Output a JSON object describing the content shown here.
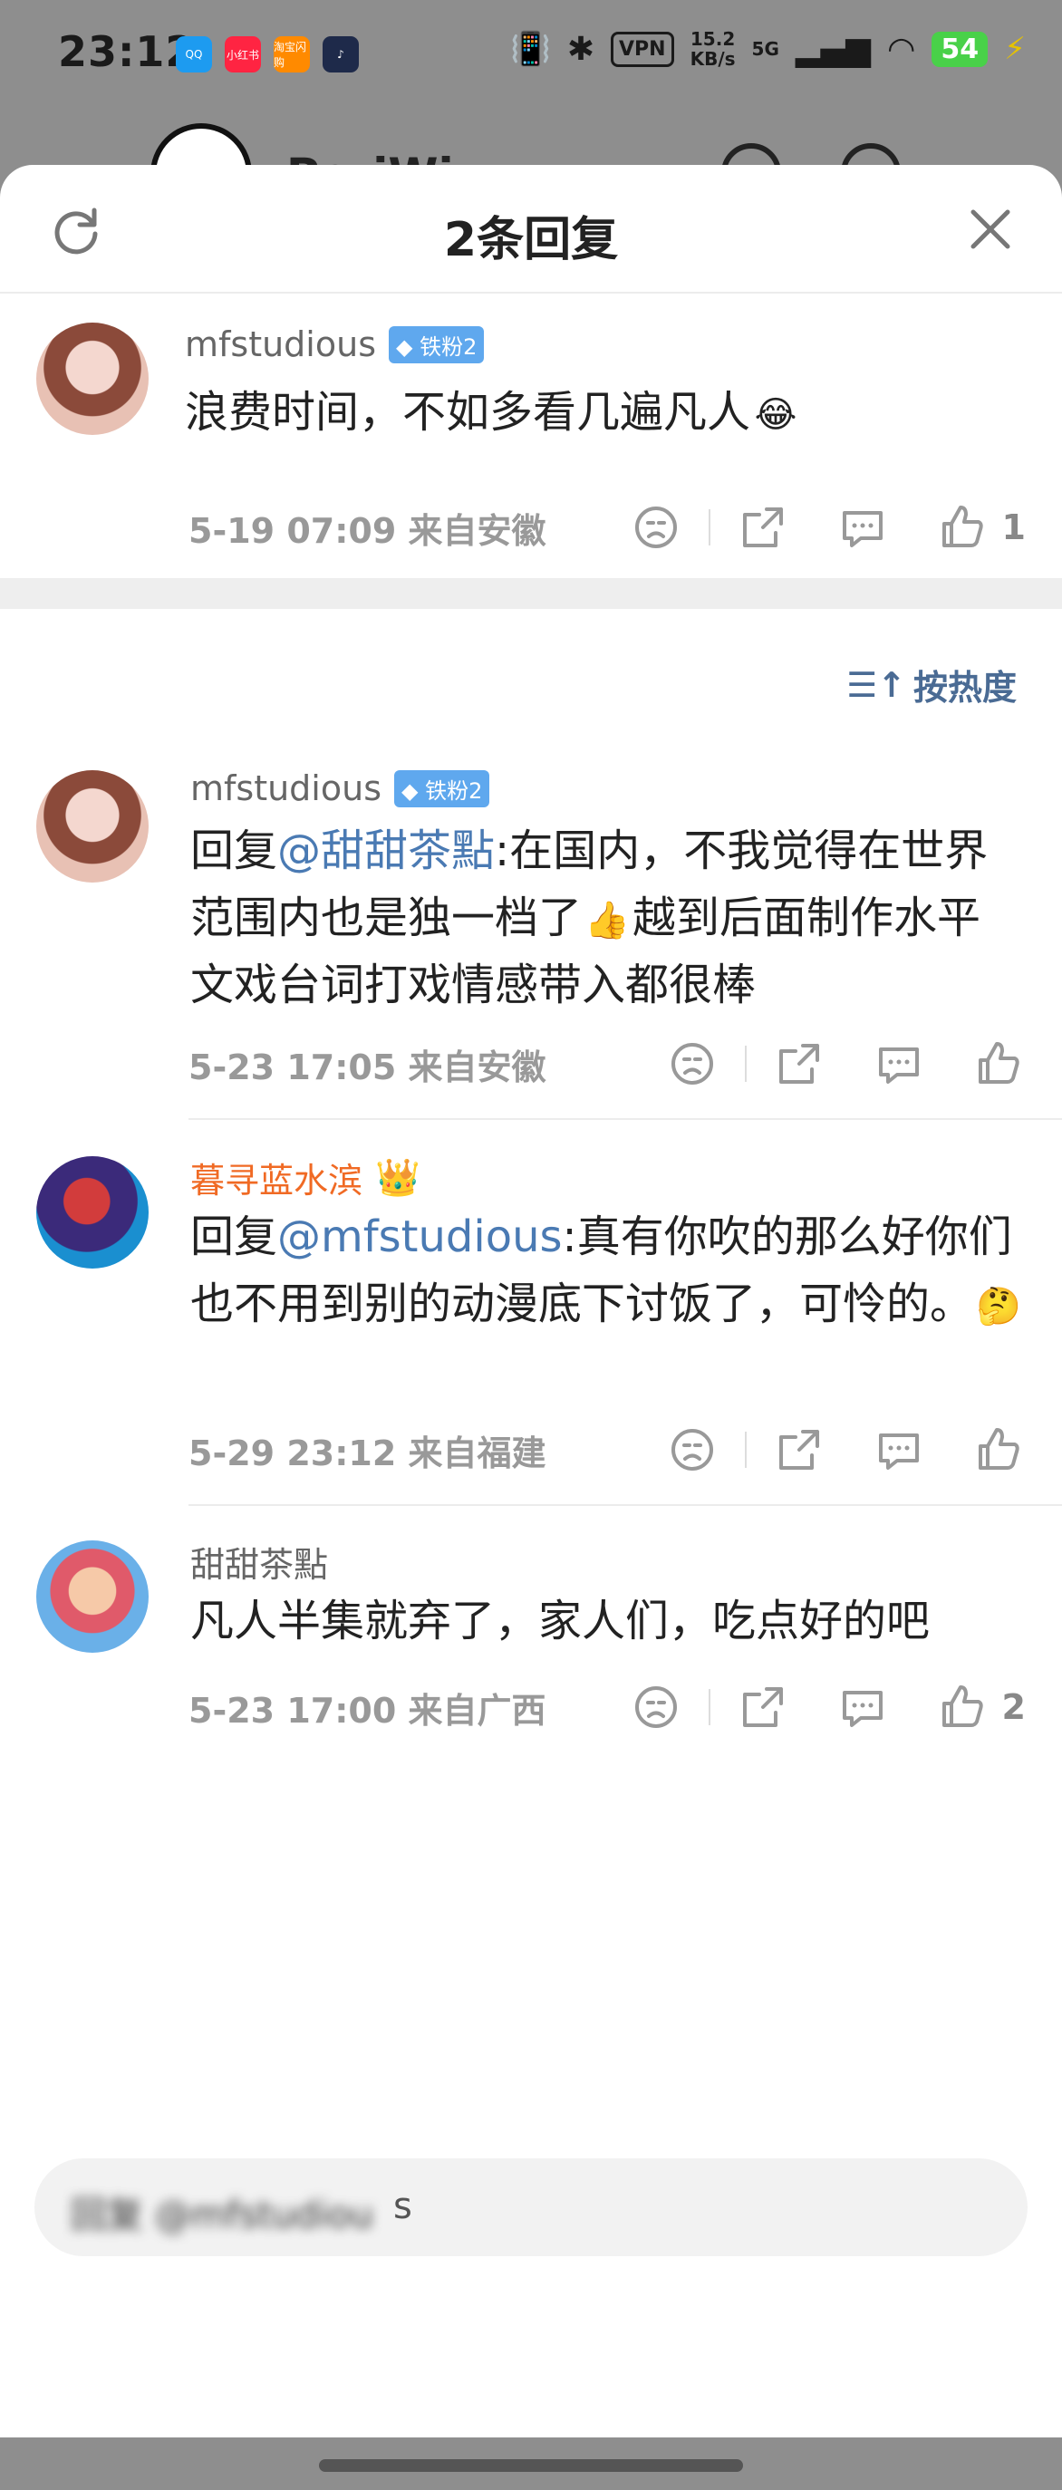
{
  "status_bar": {
    "time": "23:12",
    "vpn": "VPN",
    "speed_value": "15.2",
    "speed_unit": "KB/s",
    "network": "5G",
    "battery": "54",
    "app_icons": [
      {
        "name": "qq-icon",
        "color": "#1d9bf0",
        "label": "QQ"
      },
      {
        "name": "xiaohongshu-icon",
        "color": "#ff2442",
        "label": "小红书"
      },
      {
        "name": "taobao-flash-icon",
        "color": "#ff8a00",
        "label": "淘宝闪购"
      },
      {
        "name": "music-app-icon",
        "color": "#1e2a4a",
        "label": "♪"
      }
    ]
  },
  "background_header": {
    "back_glyph": "‹",
    "title_fragment": "PeriWi"
  },
  "sheet": {
    "title": "2条回复",
    "sort_label": "按热度"
  },
  "colors": {
    "mention": "#4a7ab3",
    "vip_name": "#f06a24",
    "fan_badge": "#5fa8ee",
    "sort": "#4a6b94"
  },
  "root_comment": {
    "username": "mfstudious",
    "badge": "铁粉2",
    "text": "浪费时间，不如多看几遍凡人",
    "emoji": "😂",
    "meta": "5-19 07:09  来自安徽",
    "likes": "1"
  },
  "replies": [
    {
      "username": "mfstudious",
      "badge": "铁粉2",
      "prefix": "回复",
      "mention": "@甜甜茶點",
      "text_a": ":在国内，不我觉得在世界范围内也是独一档了",
      "emoji": "👍",
      "text_b": "越到后面制作水平文戏台词打戏情感带入都很棒",
      "meta": "5-23 17:05  来自安徽"
    },
    {
      "username": "暮寻蓝水滨",
      "crown": "👑",
      "prefix": "回复",
      "mention": "@mfstudious",
      "text_a": ":真有你吹的那么好你们也不用到别的动漫底下讨饭了，可怜的。",
      "emoji": "🤔",
      "meta": "5-29 23:12  来自福建"
    },
    {
      "username": "甜甜茶點",
      "text": "凡人半集就弃了，家人们，吃点好的吧",
      "meta": "5-23 17:00  来自广西",
      "likes": "2"
    }
  ],
  "input_bar": {
    "obscured_text": "回复 @mfstudiou",
    "visible_tail": "s"
  }
}
